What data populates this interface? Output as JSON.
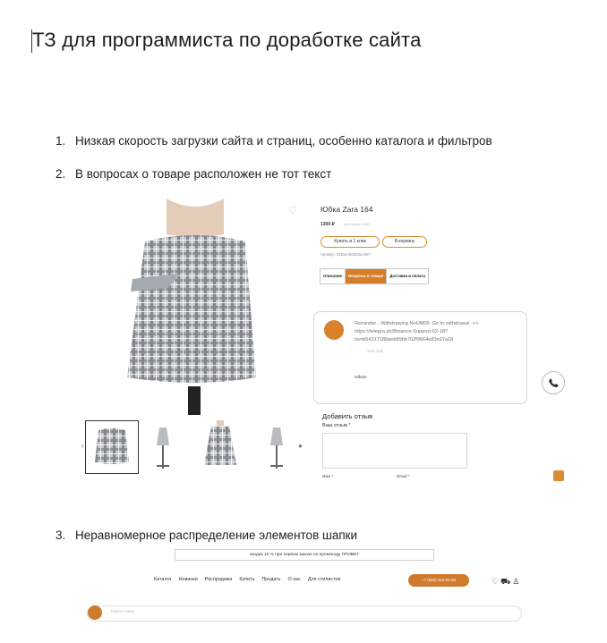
{
  "doc": {
    "title": "ТЗ для программиста по доработке сайта",
    "items": [
      {
        "num": "1.",
        "text": "Низкая скорость загрузки сайта и страниц, особенно каталога и фильтров"
      },
      {
        "num": "2.",
        "text": "В вопросах о товаре расположен не тот текст"
      },
      {
        "num": "3.",
        "text": "Неравномерное распределение элементов шапки"
      }
    ]
  },
  "product": {
    "title": "Юбка Zara 164",
    "price": "1300 ₽",
    "price_old": "розничная 2800",
    "buy_one_click": "Купить в 1 клик",
    "add_to_cart": "В корзину",
    "sku": "Артикул: 91518-2502251-007",
    "tabs": [
      "Описание",
      "Вопросы о товаре",
      "Доставка и оплата"
    ],
    "question": {
      "text": "Reminder - Withdrawing NoUM09. Go to withdrawal ->> https://telegra.ph/Binance-Support-02-18?hs=b54317189aeb89bb702f9664e83e97a18",
      "date": "19.02.2025",
      "user": "tvfkDe"
    },
    "review": {
      "heading": "Добавить отзыв",
      "label": "Ваш отзыв *",
      "name_label": "Имя *",
      "email_label": "Email *"
    }
  },
  "header": {
    "promo": "скидка 10 % при первом заказе по промокоду ПРИВЕТ",
    "nav": [
      "Каталог",
      "Новинки",
      "Распродажа",
      "Купить",
      "Продать",
      "О нас",
      "Для стилистов"
    ],
    "phone": "+7 (925) 444-06-48",
    "search_placeholder": "Найти товар"
  },
  "colors": {
    "accent": "#d98c34",
    "skirt": "#9aa1a8"
  }
}
